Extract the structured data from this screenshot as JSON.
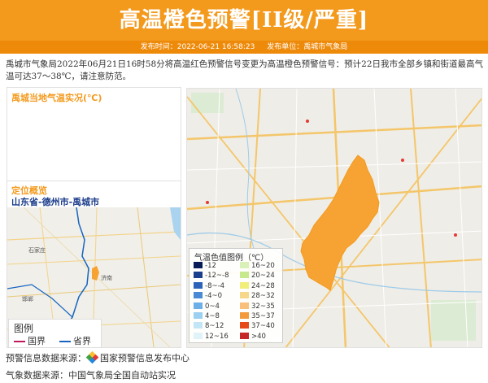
{
  "header": {
    "title": "高温橙色预警[II级/严重]",
    "publish_time_label": "发布时间：",
    "publish_time": "2022-06-21 16:58:23",
    "publisher_label": "发布单位：",
    "publisher": "禹城市气象局"
  },
  "description": "禹城市气象局2022年06月21日16时58分将高温红色预警信号变更为高温橙色预警信号：预计22日我市全部乡镇和街道最高气温可达37～38℃，请注意防范。",
  "weather_panel": {
    "title": "禹城当地气温实况(℃)"
  },
  "location_panel": {
    "title": "定位概览",
    "path": "山东省-德州市-禹城市"
  },
  "location_map": {
    "labels": [
      "石家庄",
      "济南",
      "邯郸"
    ]
  },
  "small_legend": {
    "title": "图例",
    "items": [
      {
        "label": "国界",
        "color": "#c2185b"
      },
      {
        "label": "省界",
        "color": "#1565c0"
      }
    ]
  },
  "temp_legend": {
    "title": "气温色值图例（℃）",
    "items": [
      {
        "label": "-12",
        "color": "#081d58"
      },
      {
        "label": "-12~-8",
        "color": "#1a3f8c"
      },
      {
        "label": "-8~-4",
        "color": "#2c63b8"
      },
      {
        "label": "-4~0",
        "color": "#4a8ad4"
      },
      {
        "label": "0~4",
        "color": "#6db0e8"
      },
      {
        "label": "4~8",
        "color": "#9bd0f0"
      },
      {
        "label": "8~12",
        "color": "#c2e6f5"
      },
      {
        "label": "12~16",
        "color": "#e0f3f8"
      },
      {
        "label": "16~20",
        "color": "#d9f0b8"
      },
      {
        "label": "20~24",
        "color": "#c7e88c"
      },
      {
        "label": "24~28",
        "color": "#f2ee7a"
      },
      {
        "label": "28~32",
        "color": "#f7d88a"
      },
      {
        "label": "32~35",
        "color": "#f9c07a"
      },
      {
        "label": "35~37",
        "color": "#f39a3d"
      },
      {
        "label": "37~40",
        "color": "#e64a19"
      },
      {
        "label": ">40",
        "color": "#c62828"
      }
    ]
  },
  "footer": {
    "warning_source_label": "预警信息数据来源：",
    "warning_source": "国家预警信息发布中心",
    "weather_source_label": "气象数据来源：",
    "weather_source": "中国气象局全国自动站实况"
  },
  "colors": {
    "accent": "#f39a1d",
    "warning_region": "#f7a333",
    "location_path": "#1a3b8a"
  }
}
